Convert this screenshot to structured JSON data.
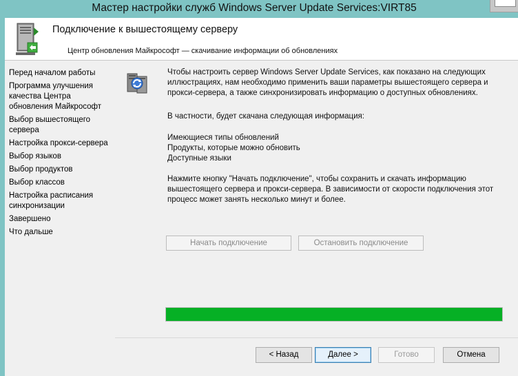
{
  "window": {
    "title": "Мастер настройки служб Windows Server Update Services:VIRT85"
  },
  "header": {
    "title": "Подключение к вышестоящему серверу",
    "subtitle": "Центр обновления Майкрософт — скачивание информации об обновлениях"
  },
  "sidebar": {
    "items": [
      {
        "label": "Перед началом работы"
      },
      {
        "label": "Программа улучшения качества Центра обновления Майкрософт"
      },
      {
        "label": "Выбор вышестоящего сервера"
      },
      {
        "label": "Настройка прокси-сервера"
      },
      {
        "label": "Выбор языков"
      },
      {
        "label": "Выбор продуктов"
      },
      {
        "label": "Выбор классов"
      },
      {
        "label": "Настройка расписания синхронизации"
      },
      {
        "label": "Завершено"
      },
      {
        "label": "Что дальше"
      }
    ]
  },
  "main": {
    "intro": "Чтобы настроить сервер Windows Server Update Services, как показано на следующих иллюстрациях, нам необходимо применить ваши параметры вышестоящего сервера и прокси-сервера, а также синхронизировать информацию о доступных обновлениях.",
    "particular": "В частности, будет скачана следующая информация:",
    "info_items": [
      "Имеющиеся типы обновлений",
      "Продукты, которые можно обновить",
      "Доступные языки"
    ],
    "instruction": "Нажмите кнопку \"Начать подключение\", чтобы сохранить и скачать информацию вышестоящего сервера и прокси-сервера. В зависимости от скорости подключения этот процесс может занять несколько минут и более.",
    "start_button": "Начать подключение",
    "stop_button": "Остановить подключение",
    "progress": 100,
    "progress_color": "#06b025"
  },
  "footer": {
    "back": "< Назад",
    "next": "Далее >",
    "finish": "Готово",
    "cancel": "Отмена"
  },
  "icons": {
    "header": "server-upload-icon",
    "main": "server-sync-icon"
  }
}
